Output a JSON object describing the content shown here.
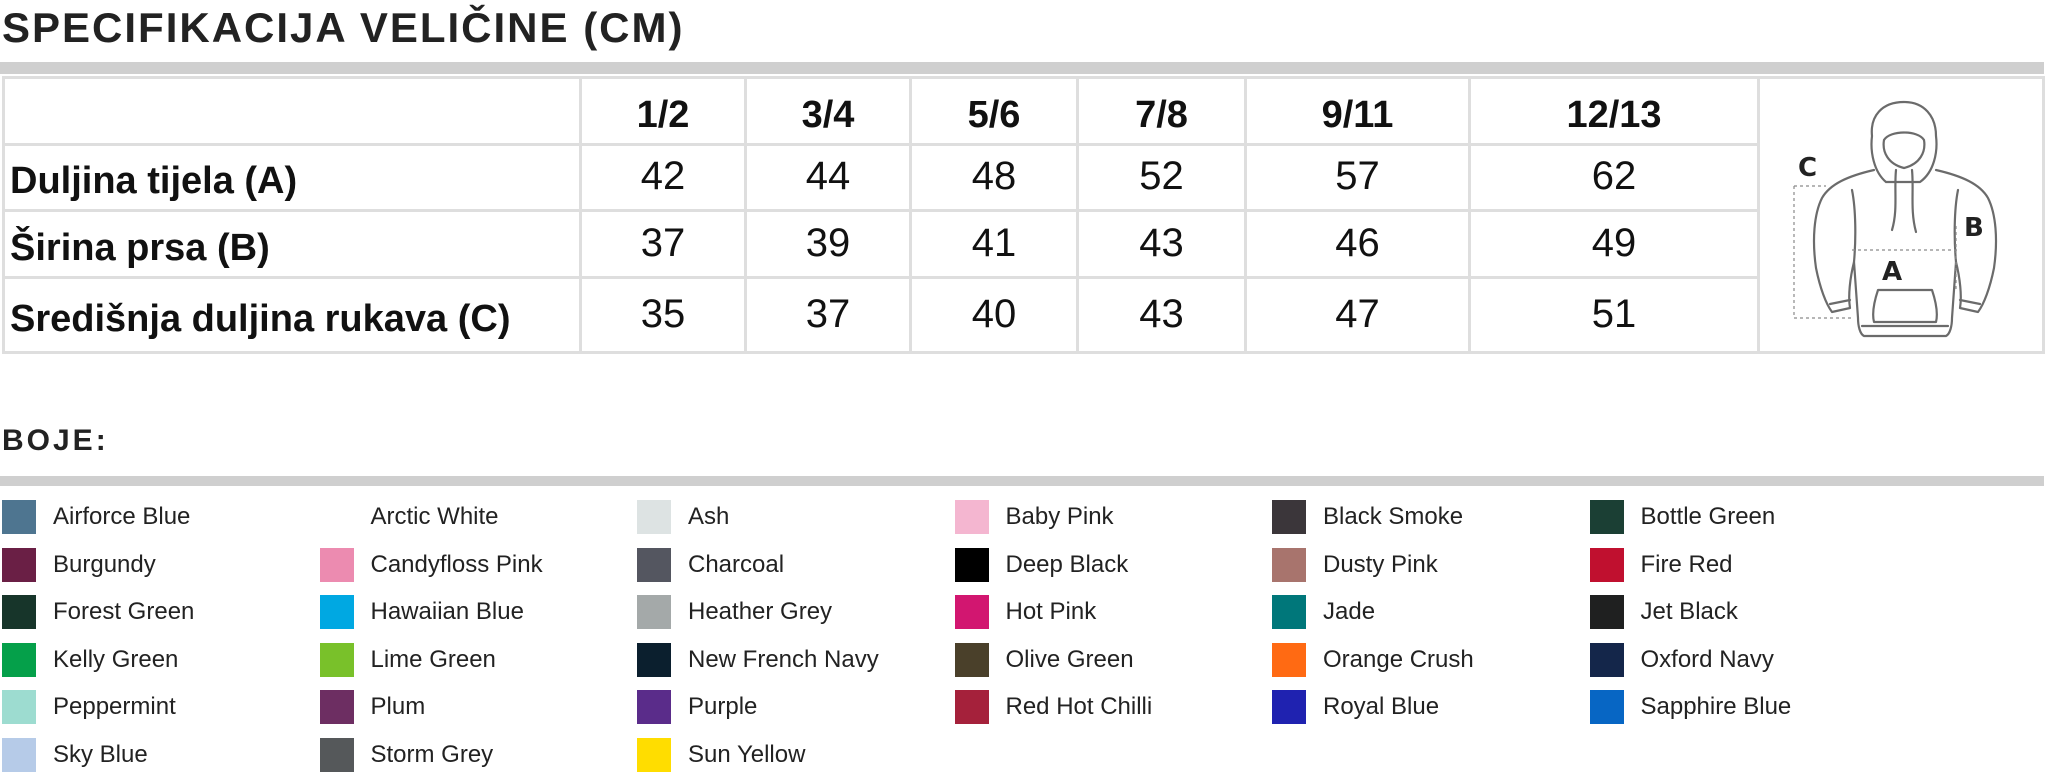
{
  "title": "SPECIFIKACIJA VELIČINE (CM)",
  "size_table": {
    "sizes": [
      "1/2",
      "3/4",
      "5/6",
      "7/8",
      "9/11",
      "12/13"
    ],
    "rows": [
      {
        "label": "Duljina tijela (A)",
        "values": [
          "42",
          "44",
          "48",
          "52",
          "57",
          "62"
        ]
      },
      {
        "label": "Širina prsa (B)",
        "values": [
          "37",
          "39",
          "41",
          "43",
          "46",
          "49"
        ]
      },
      {
        "label": "Središnja duljina rukava (C)",
        "values": [
          "35",
          "37",
          "40",
          "43",
          "47",
          "51"
        ]
      }
    ],
    "diagram": {
      "icon": "hoodie-measurement-diagram",
      "labels": [
        "C",
        "B",
        "A"
      ]
    }
  },
  "colors_title": "BOJE:",
  "colors": [
    {
      "name": "Airforce Blue",
      "hex": "#4e7590"
    },
    {
      "name": "Arctic White",
      "hex": "#ffffff"
    },
    {
      "name": "Ash",
      "hex": "#dde3e3"
    },
    {
      "name": "Baby Pink",
      "hex": "#f4b6d0"
    },
    {
      "name": "Black Smoke",
      "hex": "#3b363a"
    },
    {
      "name": "Bottle Green",
      "hex": "#1b3f34"
    },
    {
      "name": "Burgundy",
      "hex": "#6a1f45"
    },
    {
      "name": "Candyfloss Pink",
      "hex": "#ec8bb0"
    },
    {
      "name": "Charcoal",
      "hex": "#545660"
    },
    {
      "name": "Deep Black",
      "hex": "#000000"
    },
    {
      "name": "Dusty Pink",
      "hex": "#a8746d"
    },
    {
      "name": "Fire Red",
      "hex": "#c0102f"
    },
    {
      "name": "Forest Green",
      "hex": "#17352a"
    },
    {
      "name": "Hawaiian Blue",
      "hex": "#00a8e2"
    },
    {
      "name": "Heather Grey",
      "hex": "#a4a9a9"
    },
    {
      "name": "Hot Pink",
      "hex": "#d21670"
    },
    {
      "name": "Jade",
      "hex": "#00777a"
    },
    {
      "name": "Jet Black",
      "hex": "#1f2020"
    },
    {
      "name": "Kelly Green",
      "hex": "#05a04a"
    },
    {
      "name": "Lime Green",
      "hex": "#79c12a"
    },
    {
      "name": "New French Navy",
      "hex": "#0b1f2e"
    },
    {
      "name": "Olive Green",
      "hex": "#4a402a"
    },
    {
      "name": "Orange Crush",
      "hex": "#ff6a13"
    },
    {
      "name": "Oxford Navy",
      "hex": "#14264a"
    },
    {
      "name": "Peppermint",
      "hex": "#9ddcd0"
    },
    {
      "name": "Plum",
      "hex": "#6d2e62"
    },
    {
      "name": "Purple",
      "hex": "#5a2c8a"
    },
    {
      "name": "Red Hot Chilli",
      "hex": "#a5213b"
    },
    {
      "name": "Royal Blue",
      "hex": "#1f22b0"
    },
    {
      "name": "Sapphire Blue",
      "hex": "#0766c4"
    },
    {
      "name": "Sky Blue",
      "hex": "#b6cbe8"
    },
    {
      "name": "Storm Grey",
      "hex": "#55585a"
    },
    {
      "name": "Sun Yellow",
      "hex": "#ffdd00"
    }
  ]
}
